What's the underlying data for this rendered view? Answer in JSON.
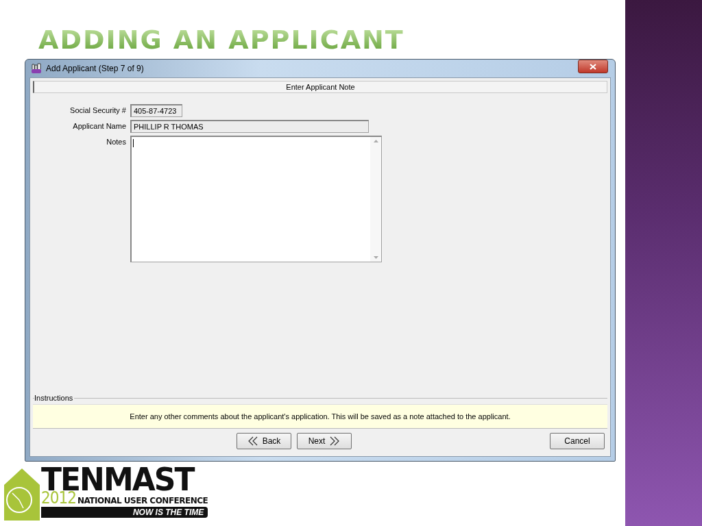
{
  "slide": {
    "title": "ADDING AN APPLICANT"
  },
  "window": {
    "title": "Add Applicant (Step 7 of 9)",
    "header": "Enter Applicant Note",
    "fields": [
      {
        "label": "Social Security #",
        "value": "405-87-4723",
        "kind": "short"
      },
      {
        "label": "Applicant Name",
        "value": "PHILLIP R THOMAS",
        "kind": "long"
      }
    ],
    "notes": {
      "label": "Notes"
    },
    "instructions": {
      "legend": "Instructions",
      "text": "Enter any other comments about the applicant's application.  This will be saved as a note attached to the applicant."
    },
    "buttons": [
      {
        "label": "Back",
        "kind": "back"
      },
      {
        "label": "Next",
        "kind": "next"
      },
      {
        "label": "Cancel",
        "kind": "cancel"
      }
    ]
  },
  "logo": {
    "name": "TENMAST",
    "year": "2012",
    "subtitle": "NATIONAL USER CONFERENCE",
    "tagline": "NOW IS THE TIME"
  }
}
